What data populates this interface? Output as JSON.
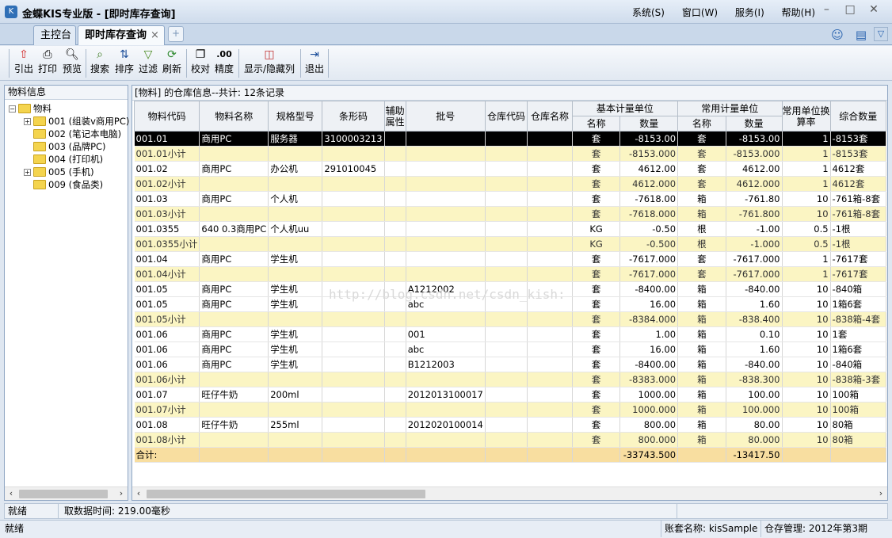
{
  "app": {
    "title": "金蝶KIS专业版 - [即时库存查询]",
    "menus": [
      "系统(S)",
      "窗口(W)",
      "服务(I)",
      "帮助(H)"
    ]
  },
  "tabs": {
    "home": "主控台",
    "current": "即时库存查询",
    "close": "×",
    "add": "+"
  },
  "toolbar": {
    "export": "引出",
    "print": "打印",
    "preview": "预览",
    "search": "搜索",
    "sort": "排序",
    "filter": "过滤",
    "refresh": "刷新",
    "check": "校对",
    "precision": "精度",
    "precision_icon": ".00",
    "show_hide": "显示/隐藏列",
    "exit": "退出"
  },
  "left_panel": {
    "title": "物料信息",
    "tree": {
      "root": "物料",
      "items": [
        "001 (组装v商用PC)",
        "002 (笔记本电脑)",
        "003 (品牌PC)",
        "004 (打印机)",
        "005 (手机)",
        "009 (食品类)"
      ]
    }
  },
  "main": {
    "info": "[物料]  的仓库信息--共计: 12条记录",
    "watermark": "http://blog.csdn.net/csdn_kish:",
    "headers": {
      "code": "物料代码",
      "name": "物料名称",
      "spec": "规格型号",
      "barcode": "条形码",
      "aux": "辅助属性",
      "batch": "批号",
      "wh_code": "仓库代码",
      "wh_name": "仓库名称",
      "base_unit": "基本计量单位",
      "common_unit": "常用计量单位",
      "rate": "常用单位换算率",
      "total_qty": "综合数量",
      "unit_name": "名称",
      "qty": "数量"
    },
    "rows": [
      {
        "t": "sel",
        "c": [
          "001.01",
          "商用PC",
          "服务器",
          "3100003213",
          "",
          "",
          "",
          "",
          "套",
          "-8153.00",
          "套",
          "-8153.00",
          "1",
          "-8153套"
        ]
      },
      {
        "t": "sub",
        "c": [
          "001.01小计",
          "",
          "",
          "",
          "",
          "",
          "",
          "",
          "套",
          "-8153.000",
          "套",
          "-8153.000",
          "1",
          "-8153套"
        ]
      },
      {
        "t": "row",
        "c": [
          "001.02",
          "商用PC",
          "办公机",
          "291010045",
          "",
          "",
          "",
          "",
          "套",
          "4612.00",
          "套",
          "4612.00",
          "1",
          "4612套"
        ]
      },
      {
        "t": "sub",
        "c": [
          "001.02小计",
          "",
          "",
          "",
          "",
          "",
          "",
          "",
          "套",
          "4612.000",
          "套",
          "4612.000",
          "1",
          "4612套"
        ]
      },
      {
        "t": "row",
        "c": [
          "001.03",
          "商用PC",
          "个人机",
          "",
          "",
          "",
          "",
          "",
          "套",
          "-7618.00",
          "箱",
          "-761.80",
          "10",
          "-761箱-8套"
        ]
      },
      {
        "t": "sub",
        "c": [
          "001.03小计",
          "",
          "",
          "",
          "",
          "",
          "",
          "",
          "套",
          "-7618.000",
          "箱",
          "-761.800",
          "10",
          "-761箱-8套"
        ]
      },
      {
        "t": "row",
        "c": [
          "001.0355",
          "640 0.3商用PC",
          "个人机uu",
          "",
          "",
          "",
          "",
          "",
          "KG",
          "-0.50",
          "根",
          "-1.00",
          "0.5",
          "-1根"
        ]
      },
      {
        "t": "sub",
        "c": [
          "001.0355小计",
          "",
          "",
          "",
          "",
          "",
          "",
          "",
          "KG",
          "-0.500",
          "根",
          "-1.000",
          "0.5",
          "-1根"
        ]
      },
      {
        "t": "row",
        "c": [
          "001.04",
          "商用PC",
          "学生机",
          "",
          "",
          "",
          "",
          "",
          "套",
          "-7617.000",
          "套",
          "-7617.000",
          "1",
          "-7617套"
        ]
      },
      {
        "t": "sub",
        "c": [
          "001.04小计",
          "",
          "",
          "",
          "",
          "",
          "",
          "",
          "套",
          "-7617.000",
          "套",
          "-7617.000",
          "1",
          "-7617套"
        ]
      },
      {
        "t": "row",
        "c": [
          "001.05",
          "商用PC",
          "学生机",
          "",
          "",
          "A1212002",
          "",
          "",
          "套",
          "-8400.00",
          "箱",
          "-840.00",
          "10",
          "-840箱"
        ]
      },
      {
        "t": "row",
        "c": [
          "001.05",
          "商用PC",
          "学生机",
          "",
          "",
          "abc",
          "",
          "",
          "套",
          "16.00",
          "箱",
          "1.60",
          "10",
          "1箱6套"
        ]
      },
      {
        "t": "sub",
        "c": [
          "001.05小计",
          "",
          "",
          "",
          "",
          "",
          "",
          "",
          "套",
          "-8384.000",
          "箱",
          "-838.400",
          "10",
          "-838箱-4套"
        ]
      },
      {
        "t": "row",
        "c": [
          "001.06",
          "商用PC",
          "学生机",
          "",
          "",
          "001",
          "",
          "",
          "套",
          "1.00",
          "箱",
          "0.10",
          "10",
          "1套"
        ]
      },
      {
        "t": "row",
        "c": [
          "001.06",
          "商用PC",
          "学生机",
          "",
          "",
          "abc",
          "",
          "",
          "套",
          "16.00",
          "箱",
          "1.60",
          "10",
          "1箱6套"
        ]
      },
      {
        "t": "row",
        "c": [
          "001.06",
          "商用PC",
          "学生机",
          "",
          "",
          "B1212003",
          "",
          "",
          "套",
          "-8400.00",
          "箱",
          "-840.00",
          "10",
          "-840箱"
        ]
      },
      {
        "t": "sub",
        "c": [
          "001.06小计",
          "",
          "",
          "",
          "",
          "",
          "",
          "",
          "套",
          "-8383.000",
          "箱",
          "-838.300",
          "10",
          "-838箱-3套"
        ]
      },
      {
        "t": "row",
        "c": [
          "001.07",
          "旺仔牛奶",
          "200ml",
          "",
          "",
          "2012013100017",
          "",
          "",
          "套",
          "1000.00",
          "箱",
          "100.00",
          "10",
          "100箱"
        ]
      },
      {
        "t": "sub",
        "c": [
          "001.07小计",
          "",
          "",
          "",
          "",
          "",
          "",
          "",
          "套",
          "1000.000",
          "箱",
          "100.000",
          "10",
          "100箱"
        ]
      },
      {
        "t": "row",
        "c": [
          "001.08",
          "旺仔牛奶",
          "255ml",
          "",
          "",
          "2012020100014",
          "",
          "",
          "套",
          "800.00",
          "箱",
          "80.00",
          "10",
          "80箱"
        ]
      },
      {
        "t": "sub",
        "c": [
          "001.08小计",
          "",
          "",
          "",
          "",
          "",
          "",
          "",
          "套",
          "800.000",
          "箱",
          "80.000",
          "10",
          "80箱"
        ]
      },
      {
        "t": "total",
        "c": [
          "合计:",
          "",
          "",
          "",
          "",
          "",
          "",
          "",
          "",
          "-33743.500",
          "",
          "-13417.50",
          "",
          ""
        ]
      }
    ]
  },
  "status": {
    "ready": "就绪",
    "fetch_time": "取数据时间: 219.00毫秒",
    "ready2": "就绪",
    "account": "账套名称: kisSample",
    "period": "仓存管理: 2012年第3期"
  }
}
